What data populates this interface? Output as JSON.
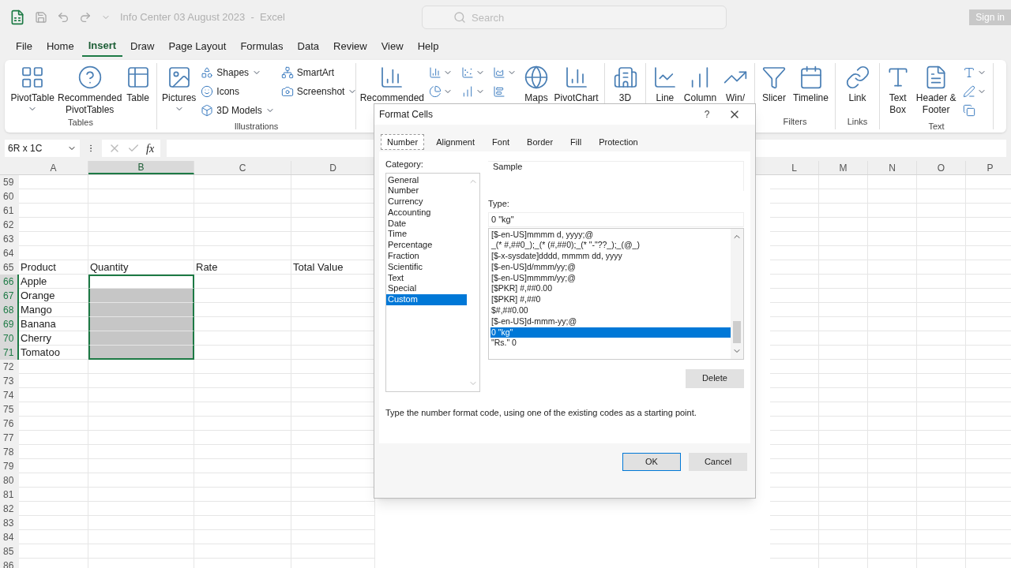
{
  "title_bar": {
    "title": "Info Center 03 August 2023  -  Excel",
    "search": {
      "placeholder": "Search"
    },
    "sign_in": "Sign in"
  },
  "menu_tabs": [
    {
      "label": "File",
      "selected": false
    },
    {
      "label": "Home",
      "selected": false
    },
    {
      "label": "Insert",
      "selected": true
    },
    {
      "label": "Draw",
      "selected": false
    },
    {
      "label": "Page Layout",
      "selected": false
    },
    {
      "label": "Formulas",
      "selected": false
    },
    {
      "label": "Data",
      "selected": false
    },
    {
      "label": "Review",
      "selected": false
    },
    {
      "label": "View",
      "selected": false
    },
    {
      "label": "Help",
      "selected": false
    }
  ],
  "ribbon": {
    "groups": [
      {
        "label": "Tables",
        "items": [
          {
            "kind": "large",
            "label": "PivotTable",
            "dropdown": true
          },
          {
            "kind": "large",
            "label": "Recommended PivotTables",
            "dropdown": false
          },
          {
            "kind": "large",
            "label": "Table",
            "dropdown": false
          }
        ]
      },
      {
        "label": "Illustrations",
        "items": [
          {
            "kind": "large",
            "label": "Pictures",
            "dropdown": true
          },
          {
            "kind": "small",
            "label": "Shapes",
            "dropdown": true
          },
          {
            "kind": "small",
            "label": "Icons",
            "dropdown": false
          },
          {
            "kind": "small",
            "label": "3D Models",
            "dropdown": true
          },
          {
            "kind": "small",
            "label": "SmartArt",
            "dropdown": false
          },
          {
            "kind": "small",
            "label": "Screenshot",
            "dropdown": true
          }
        ]
      },
      {
        "items": [
          {
            "kind": "large",
            "label": "Recommended",
            "dropdown": false
          },
          {
            "kind": "icon",
            "dropdown": true
          },
          {
            "kind": "icon",
            "dropdown": true
          },
          {
            "kind": "icon",
            "dropdown": true
          },
          {
            "kind": "icon",
            "dropdown": true
          },
          {
            "kind": "icon",
            "dropdown": true
          },
          {
            "kind": "icon",
            "dropdown": false
          },
          {
            "kind": "large",
            "label": "Maps",
            "dropdown": false
          },
          {
            "kind": "large",
            "label": "PivotChart",
            "dropdown": false
          }
        ]
      },
      {
        "items": [
          {
            "kind": "large",
            "label": "3D",
            "dropdown": false
          }
        ]
      },
      {
        "items": [
          {
            "kind": "large",
            "label": "Line",
            "dropdown": false
          },
          {
            "kind": "large",
            "label": "Column",
            "dropdown": false
          },
          {
            "kind": "large",
            "label": "Win/",
            "dropdown": false
          }
        ]
      },
      {
        "label": "Filters",
        "items": [
          {
            "kind": "large",
            "label": "Slicer",
            "dropdown": false
          },
          {
            "kind": "large",
            "label": "Timeline",
            "dropdown": false
          }
        ]
      },
      {
        "label": "Links",
        "items": [
          {
            "kind": "large",
            "label": "Link",
            "dropdown": false
          }
        ]
      },
      {
        "label": "Text",
        "items": [
          {
            "kind": "large",
            "label": "Text Box",
            "dropdown": false
          },
          {
            "kind": "large",
            "label": "Header & Footer",
            "dropdown": false
          },
          {
            "kind": "icon",
            "dropdown": true
          },
          {
            "kind": "icon",
            "dropdown": true
          },
          {
            "kind": "icon",
            "dropdown": false
          }
        ]
      }
    ]
  },
  "formula_bar": {
    "name_box": "6R x 1C",
    "function_label": "fx"
  },
  "sheet": {
    "columns_left": [
      {
        "letter": "A",
        "selected": false
      },
      {
        "letter": "B",
        "selected": true
      },
      {
        "letter": "C",
        "selected": false
      },
      {
        "letter": "D",
        "selected": false
      }
    ],
    "columns_right": [
      {
        "letter": "L"
      },
      {
        "letter": "M"
      },
      {
        "letter": "N"
      },
      {
        "letter": "O"
      },
      {
        "letter": "P"
      }
    ],
    "rows": [
      {
        "number": "59",
        "selected": false,
        "active": false
      },
      {
        "number": "60",
        "selected": false,
        "active": false
      },
      {
        "number": "61",
        "selected": false,
        "active": false
      },
      {
        "number": "62",
        "selected": false,
        "active": false
      },
      {
        "number": "63",
        "selected": false,
        "active": false
      },
      {
        "number": "64",
        "selected": false,
        "active": false
      },
      {
        "number": "65",
        "selected": false,
        "active": false,
        "a": "Product",
        "b": "Quantity",
        "c": "Rate",
        "d": "Total Value"
      },
      {
        "number": "66",
        "selected": true,
        "active": true,
        "a": "Apple"
      },
      {
        "number": "67",
        "selected": true,
        "active": false,
        "a": "Orange"
      },
      {
        "number": "68",
        "selected": true,
        "active": false,
        "a": "Mango"
      },
      {
        "number": "69",
        "selected": true,
        "active": false,
        "a": "Banana"
      },
      {
        "number": "70",
        "selected": true,
        "active": false,
        "a": "Cherry"
      },
      {
        "number": "71",
        "selected": true,
        "active": false,
        "a": "Tomatoo"
      },
      {
        "number": "72",
        "selected": false,
        "active": false
      },
      {
        "number": "73",
        "selected": false,
        "active": false
      },
      {
        "number": "74",
        "selected": false,
        "active": false
      },
      {
        "number": "75",
        "selected": false,
        "active": false
      },
      {
        "number": "76",
        "selected": false,
        "active": false
      },
      {
        "number": "77",
        "selected": false,
        "active": false
      },
      {
        "number": "78",
        "selected": false,
        "active": false
      },
      {
        "number": "79",
        "selected": false,
        "active": false
      },
      {
        "number": "80",
        "selected": false,
        "active": false
      },
      {
        "number": "81",
        "selected": false,
        "active": false
      },
      {
        "number": "82",
        "selected": false,
        "active": false
      },
      {
        "number": "83",
        "selected": false,
        "active": false
      },
      {
        "number": "84",
        "selected": false,
        "active": false
      },
      {
        "number": "85",
        "selected": false,
        "active": false
      },
      {
        "number": "86",
        "selected": false,
        "active": false
      }
    ]
  },
  "dialog": {
    "title": "Format Cells",
    "help": "?",
    "tabs": [
      {
        "label": "Number",
        "selected": true
      },
      {
        "label": "Alignment",
        "selected": false
      },
      {
        "label": "Font",
        "selected": false
      },
      {
        "label": "Border",
        "selected": false
      },
      {
        "label": "Fill",
        "selected": false
      },
      {
        "label": "Protection",
        "selected": false
      }
    ],
    "category_label": "Category:",
    "categories": [
      {
        "label": "General",
        "selected": false
      },
      {
        "label": "Number",
        "selected": false
      },
      {
        "label": "Currency",
        "selected": false
      },
      {
        "label": "Accounting",
        "selected": false
      },
      {
        "label": "Date",
        "selected": false
      },
      {
        "label": "Time",
        "selected": false
      },
      {
        "label": "Percentage",
        "selected": false
      },
      {
        "label": "Fraction",
        "selected": false
      },
      {
        "label": "Scientific",
        "selected": false
      },
      {
        "label": "Text",
        "selected": false
      },
      {
        "label": "Special",
        "selected": false
      },
      {
        "label": "Custom",
        "selected": true
      }
    ],
    "sample_label": "Sample",
    "type_label": "Type:",
    "type_value": "0 \"kg\"",
    "formats": [
      {
        "label": "[$-en-US]mmmm d, yyyy;@",
        "selected": false
      },
      {
        "label": "_(* #,##0_);_(* (#,##0);_(* \"-\"??_);_(@_)",
        "selected": false
      },
      {
        "label": "[$-x-sysdate]dddd, mmmm dd, yyyy",
        "selected": false
      },
      {
        "label": "[$-en-US]d/mmm/yy;@",
        "selected": false
      },
      {
        "label": "[$-en-US]mmmm/yy;@",
        "selected": false
      },
      {
        "label": "[$PKR] #,##0.00",
        "selected": false
      },
      {
        "label": "[$PKR] #,##0",
        "selected": false
      },
      {
        "label": "$#,##0.00",
        "selected": false
      },
      {
        "label": "[$-en-US]d-mmm-yy;@",
        "selected": false
      },
      {
        "label": "0 \"kg\"",
        "selected": true
      },
      {
        "label": "\"Rs.\" 0",
        "selected": false
      }
    ],
    "delete_button": "Delete",
    "hint": "Type the number format code, using one of the existing codes as a starting point.",
    "ok_button": "OK",
    "cancel_button": "Cancel"
  }
}
